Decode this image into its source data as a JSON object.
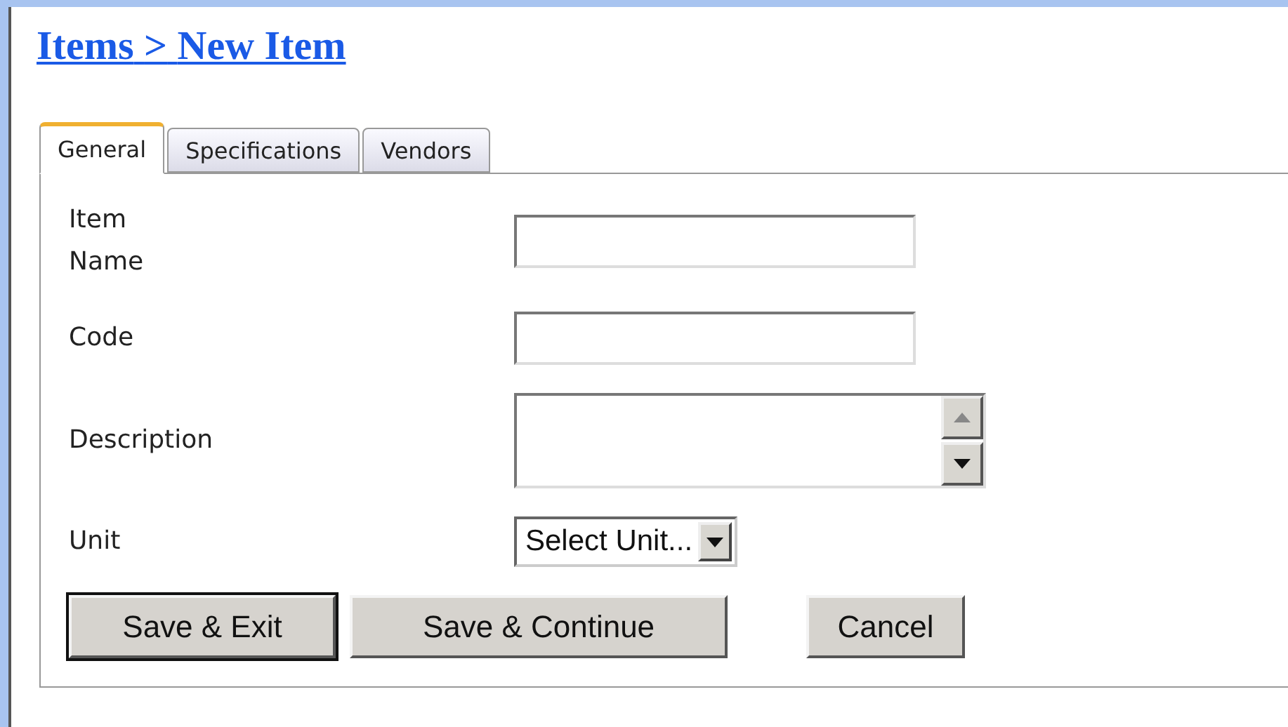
{
  "breadcrumb": {
    "parent": "Items",
    "separator": ">",
    "current": "New Item"
  },
  "tabs": [
    {
      "label": "General",
      "selected": true
    },
    {
      "label": "Specifications",
      "selected": false
    },
    {
      "label": "Vendors",
      "selected": false
    }
  ],
  "fields": [
    {
      "label": "Item Name",
      "kind": "text"
    },
    {
      "label": "Code",
      "kind": "text"
    },
    {
      "label": "Description",
      "kind": "textarea"
    },
    {
      "label": "Unit",
      "kind": "select",
      "value": "Select Unit..."
    }
  ],
  "buttons": [
    {
      "label": "Save & Exit",
      "default": true
    },
    {
      "label": "Save & Continue",
      "default": false
    },
    {
      "label": "Cancel",
      "default": false
    }
  ]
}
